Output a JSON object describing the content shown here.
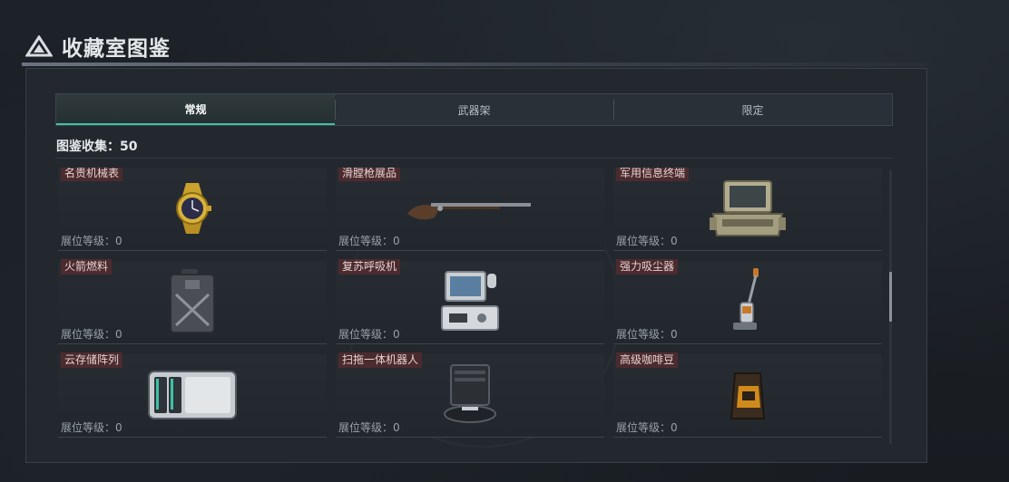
{
  "header": {
    "title": "收藏室图鉴"
  },
  "tabs": [
    {
      "label": "常规",
      "active": true
    },
    {
      "label": "武器架",
      "active": false
    },
    {
      "label": "限定",
      "active": false
    }
  ],
  "collection": {
    "count_label": "图鉴收集：50"
  },
  "items": [
    {
      "name": "名贵机械表",
      "level": "展位等级：0",
      "icon": "watch-icon"
    },
    {
      "name": "滑膛枪展品",
      "level": "展位等级：0",
      "icon": "musket-icon"
    },
    {
      "name": "军用信息终端",
      "level": "展位等级：0",
      "icon": "terminal-icon"
    },
    {
      "name": "火箭燃料",
      "level": "展位等级：0",
      "icon": "fuel-can-icon"
    },
    {
      "name": "复苏呼吸机",
      "level": "展位等级：0",
      "icon": "ventilator-icon"
    },
    {
      "name": "强力吸尘器",
      "level": "展位等级：0",
      "icon": "vacuum-icon"
    },
    {
      "name": "云存储阵列",
      "level": "展位等级：0",
      "icon": "storage-array-icon"
    },
    {
      "name": "扫拖一体机器人",
      "level": "展位等级：0",
      "icon": "robot-vacuum-icon"
    },
    {
      "name": "高级咖啡豆",
      "level": "展位等级：0",
      "icon": "coffee-bag-icon"
    }
  ],
  "colors": {
    "accent": "#3fc2a6",
    "name_tag": "#4b2b2e",
    "panel": "#23282e"
  }
}
